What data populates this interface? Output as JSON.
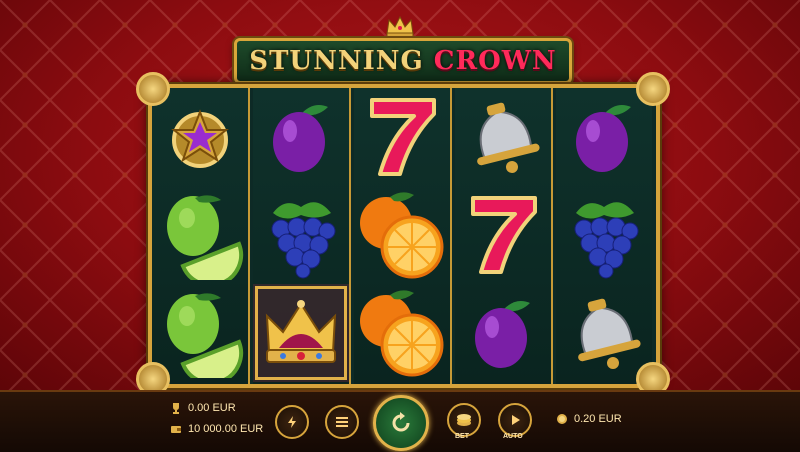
{
  "game": {
    "title_part1": "STUNNING",
    "title_part2": "CROWN"
  },
  "reels": [
    [
      "star",
      "lime",
      "lime"
    ],
    [
      "plum",
      "grapes",
      "crown"
    ],
    [
      "seven",
      "orange",
      "orange"
    ],
    [
      "bell",
      "seven",
      "plum"
    ],
    [
      "plum",
      "grapes",
      "bell"
    ]
  ],
  "highlighted_cell": {
    "reel": 2,
    "row": 3,
    "symbol": "crown"
  },
  "bottom_bar": {
    "win_value": "0.00 EUR",
    "balance_value": "10 000.00 EUR",
    "bet_value": "0.20 EUR",
    "bet_label": "BET",
    "auto_label": "AUTO",
    "icons": {
      "win": "trophy-icon",
      "balance": "wallet-icon",
      "turbo": "lightning-icon",
      "menu": "hamburger-menu-icon",
      "spin": "spin-arrow-icon",
      "bet": "coin-stack-icon",
      "auto": "autoplay-icon",
      "bet_value": "coin-icon"
    }
  },
  "colors": {
    "accent_gold": "#d6a43c",
    "title_green": "#1e4a2a",
    "crown_word": "#ff2a5a",
    "background_red": "#b0161a"
  }
}
